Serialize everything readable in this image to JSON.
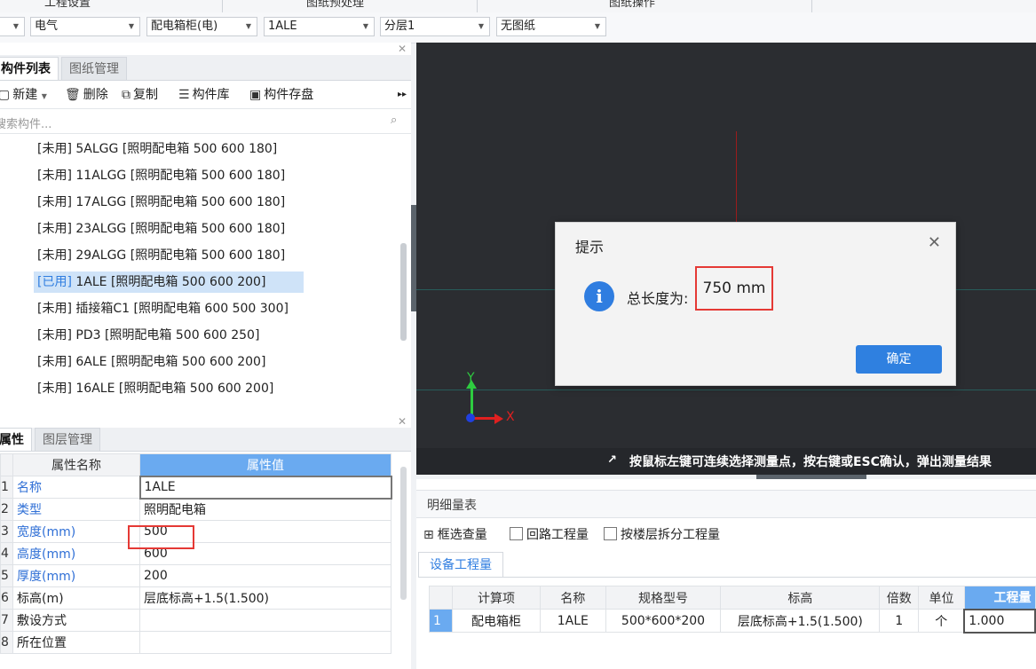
{
  "topbar": {
    "items": [
      "工程设置",
      "图纸预处理",
      "图纸操作"
    ]
  },
  "dropdowns": [
    {
      "value": ""
    },
    {
      "value": "电气"
    },
    {
      "value": "配电箱柜(电)"
    },
    {
      "value": "1ALE"
    },
    {
      "value": "分层1"
    },
    {
      "value": "无图纸"
    }
  ],
  "component_panel": {
    "tabs": [
      "构件列表",
      "图纸管理"
    ],
    "toolbar": {
      "new": "新建",
      "delete": "删除",
      "copy": "复制",
      "library": "构件库",
      "save": "构件存盘"
    },
    "search_placeholder": "搜索构件...",
    "items": [
      {
        "tag": "[未用]",
        "text": " 5ALGG [照明配电箱 500 600 180]"
      },
      {
        "tag": "[未用]",
        "text": " 11ALGG [照明配电箱 500 600 180]"
      },
      {
        "tag": "[未用]",
        "text": " 17ALGG [照明配电箱 500 600 180]"
      },
      {
        "tag": "[未用]",
        "text": " 23ALGG [照明配电箱 500 600 180]"
      },
      {
        "tag": "[未用]",
        "text": " 29ALGG [照明配电箱 500 600 180]"
      },
      {
        "tag": "[已用]",
        "text": " 1ALE [照明配电箱 500 600 200]"
      },
      {
        "tag": "[未用]",
        "text": " 插接箱C1 [照明配电箱 600 500 300]"
      },
      {
        "tag": "[未用]",
        "text": " PD3 [照明配电箱 500 600 250]"
      },
      {
        "tag": "[未用]",
        "text": " 6ALE [照明配电箱 500 600 200]"
      },
      {
        "tag": "[未用]",
        "text": " 16ALE [照明配电箱 500 600 200]"
      }
    ]
  },
  "property_panel": {
    "tabs": [
      "属性",
      "图层管理"
    ],
    "headers": [
      "属性名称",
      "属性值"
    ],
    "rows": [
      {
        "num": "1",
        "name": "名称",
        "value": "1ALE"
      },
      {
        "num": "2",
        "name": "类型",
        "value": "照明配电箱"
      },
      {
        "num": "3",
        "name": "宽度(mm)",
        "value": "500"
      },
      {
        "num": "4",
        "name": "高度(mm)",
        "value": "600"
      },
      {
        "num": "5",
        "name": "厚度(mm)",
        "value": "200"
      },
      {
        "num": "6",
        "name": "标高(m)",
        "value": "层底标高+1.5(1.500)"
      },
      {
        "num": "7",
        "name": "敷设方式",
        "value": ""
      },
      {
        "num": "8",
        "name": "所在位置",
        "value": ""
      }
    ]
  },
  "canvas": {
    "axis_y": "Y",
    "axis_x": "X",
    "status_hint": "按鼠标左键可连续选择测量点，按右键或ESC确认，弹出测量结果"
  },
  "dialog": {
    "title": "提示",
    "message": "总长度为:",
    "value": "750 mm",
    "ok": "确定"
  },
  "detail_panel": {
    "title": "明细量表",
    "box_select": "框选查量",
    "loop_qty": "回路工程量",
    "floor_split": "按楼层拆分工程量",
    "tab": "设备工程量",
    "headers": [
      "",
      "计算项",
      "名称",
      "规格型号",
      "标高",
      "倍数",
      "单位",
      "工程量"
    ],
    "rows": [
      [
        "1",
        "配电箱柜",
        "1ALE",
        "500*600*200",
        "层底标高+1.5(1.500)",
        "1",
        "个",
        "1.000"
      ]
    ]
  },
  "colors": {
    "accent": "#2f7de0",
    "highlight": "#e53935",
    "canvas": "#2b2d31"
  }
}
